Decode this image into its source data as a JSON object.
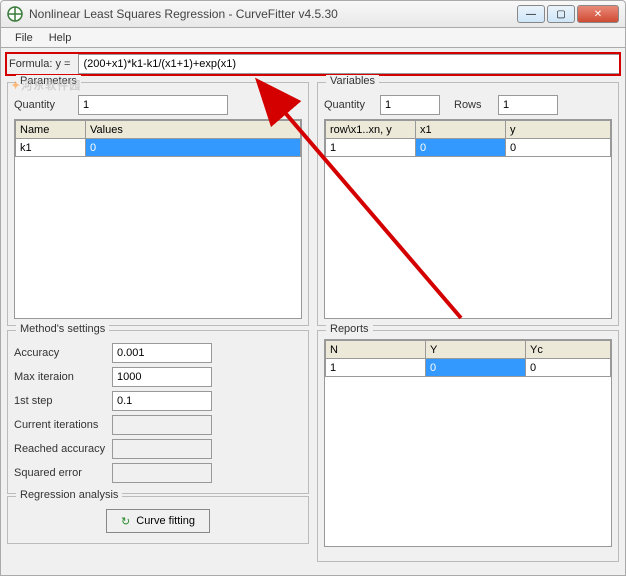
{
  "window": {
    "title": "Nonlinear Least Squares Regression - CurveFitter v4.5.30"
  },
  "menu": {
    "file": "File",
    "help": "Help"
  },
  "watermark": {
    "text_prefix": "河东软件园",
    "suffix": ""
  },
  "formula": {
    "label": "Formula: y =",
    "value": "(200+x1)*k1-k1/(x1+1)+exp(x1)"
  },
  "parameters": {
    "legend": "Parameters",
    "quantity_label": "Quantity",
    "quantity_value": "1",
    "headers": {
      "name": "Name",
      "values": "Values"
    },
    "rows": [
      {
        "name": "k1",
        "value": "0"
      }
    ]
  },
  "variables": {
    "legend": "Variables",
    "quantity_label": "Quantity",
    "quantity_value": "1",
    "rows_label": "Rows",
    "rows_value": "1",
    "headers": {
      "row": "row\\x1..xn, y",
      "x1": "x1",
      "y": "y"
    },
    "data": [
      {
        "row": "1",
        "x1": "0",
        "y": "0"
      }
    ]
  },
  "methods": {
    "legend": "Method's settings",
    "accuracy_label": "Accuracy",
    "accuracy_value": "0.001",
    "max_iter_label": "Max iteraion",
    "max_iter_value": "1000",
    "first_step_label": "1st step",
    "first_step_value": "0.1",
    "current_iter_label": "Current iterations",
    "current_iter_value": "",
    "reached_acc_label": "Reached accuracy",
    "reached_acc_value": "",
    "sq_err_label": "Squared error",
    "sq_err_value": ""
  },
  "reports": {
    "legend": "Reports",
    "headers": {
      "n": "N",
      "y": "Y",
      "yc": "Yc"
    },
    "rows": [
      {
        "n": "1",
        "y": "0",
        "yc": "0"
      }
    ]
  },
  "regression": {
    "legend": "Regression analysis",
    "button_label": "Curve fitting"
  }
}
